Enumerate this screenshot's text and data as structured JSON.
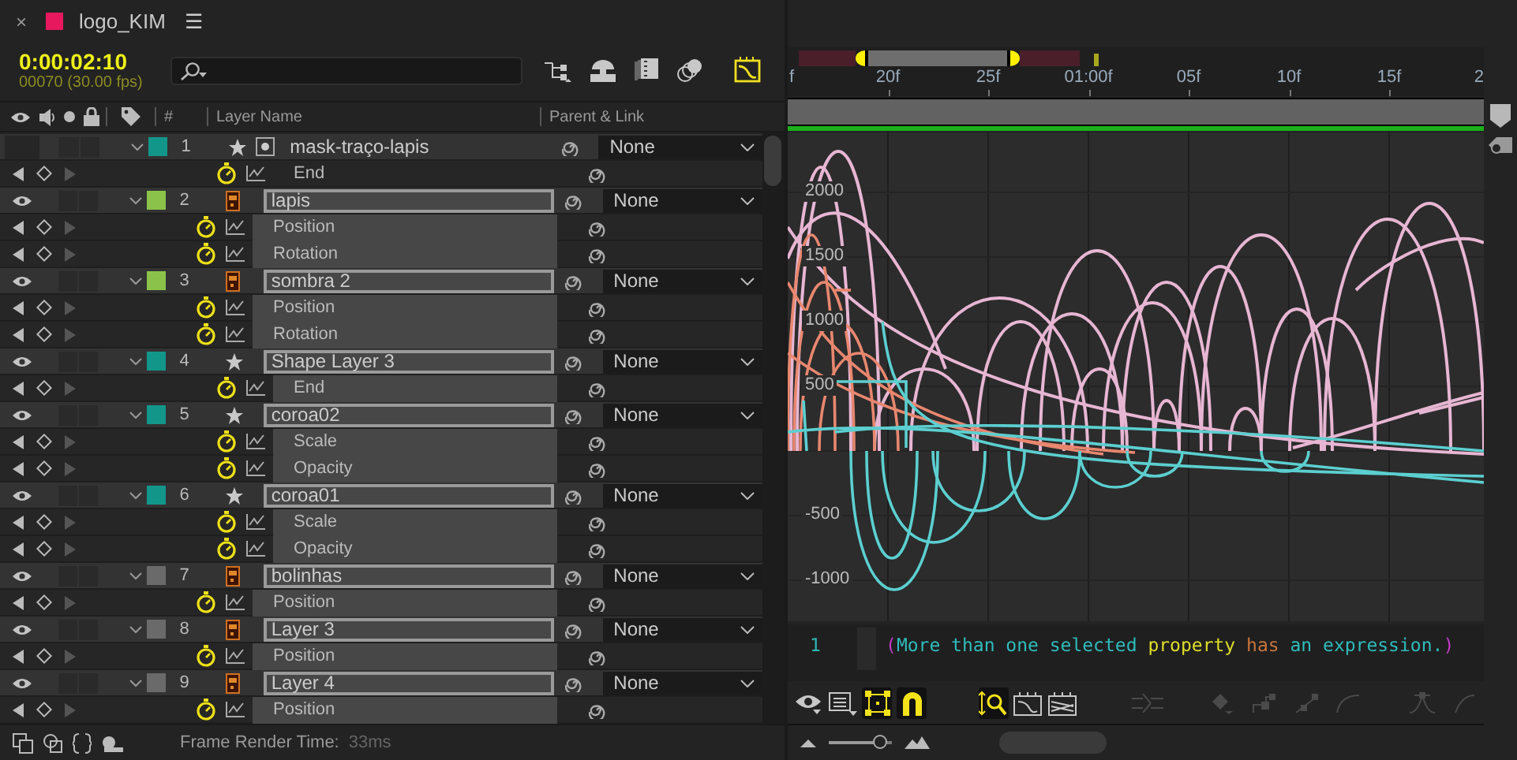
{
  "tab": {
    "close": "×",
    "title": "logo_KIM",
    "menu": "☰"
  },
  "timecode": "0:00:02:10",
  "frame": "00070 (30.00 fps)",
  "toolbar": [
    {
      "kind": "flowchart",
      "on": false
    },
    {
      "kind": "draft3d",
      "on": false
    },
    {
      "kind": "frameblend",
      "on": false
    },
    {
      "kind": "motionblur",
      "on": false
    },
    {
      "kind": "grapheditor",
      "on": true
    }
  ],
  "columns": [
    {
      "kind": "number",
      "label": "#"
    },
    {
      "kind": "name",
      "label": "Layer Name"
    },
    {
      "kind": "parent",
      "label": "Parent & Link"
    }
  ],
  "layers": [
    {
      "number": "1",
      "name": "mask-traço-lapis",
      "kind": "mask",
      "color": "#13968a",
      "visible": false,
      "solo": false,
      "locked": false,
      "selected": false,
      "parent": "None",
      "properties": [
        {
          "name": "End",
          "selected": false
        }
      ]
    },
    {
      "number": "2",
      "name": "lapis",
      "kind": "ai",
      "color": "#8bc34a",
      "visible": true,
      "solo": false,
      "locked": false,
      "selected": true,
      "parent": "None",
      "properties": [
        {
          "name": "Position",
          "selected": true
        },
        {
          "name": "Rotation",
          "selected": true
        }
      ]
    },
    {
      "number": "3",
      "name": "sombra 2",
      "kind": "ai",
      "color": "#8bc34a",
      "visible": true,
      "solo": false,
      "locked": false,
      "selected": true,
      "parent": "None",
      "properties": [
        {
          "name": "Position",
          "selected": true
        },
        {
          "name": "Rotation",
          "selected": true
        }
      ]
    },
    {
      "number": "4",
      "name": "Shape Layer 3",
      "kind": "shape",
      "color": "#13968a",
      "visible": true,
      "solo": false,
      "locked": false,
      "selected": true,
      "parent": "None",
      "properties": [
        {
          "name": "End",
          "selected": true
        }
      ]
    },
    {
      "number": "5",
      "name": "coroa02",
      "kind": "shape",
      "color": "#13968a",
      "visible": true,
      "solo": false,
      "locked": false,
      "selected": true,
      "parent": "None",
      "properties": [
        {
          "name": "Scale",
          "selected": true
        },
        {
          "name": "Opacity",
          "selected": true
        }
      ]
    },
    {
      "number": "6",
      "name": "coroa01",
      "kind": "shape",
      "color": "#13968a",
      "visible": true,
      "solo": false,
      "locked": false,
      "selected": true,
      "parent": "None",
      "properties": [
        {
          "name": "Scale",
          "selected": true
        },
        {
          "name": "Opacity",
          "selected": true
        }
      ]
    },
    {
      "number": "7",
      "name": "bolinhas",
      "kind": "ai",
      "color": "#6a6a6a",
      "visible": true,
      "solo": false,
      "locked": false,
      "selected": true,
      "parent": "None",
      "properties": [
        {
          "name": "Position",
          "selected": true
        }
      ]
    },
    {
      "number": "8",
      "name": "Layer 3",
      "kind": "ai",
      "color": "#6a6a6a",
      "visible": true,
      "solo": false,
      "locked": false,
      "selected": true,
      "parent": "None",
      "properties": [
        {
          "name": "Position",
          "selected": true
        }
      ]
    },
    {
      "number": "9",
      "name": "Layer 4",
      "kind": "ai",
      "color": "#6a6a6a",
      "visible": true,
      "solo": false,
      "locked": false,
      "selected": true,
      "parent": "None",
      "properties": [
        {
          "name": "Position",
          "selected": true
        }
      ]
    }
  ],
  "status": {
    "label": "Frame Render Time:",
    "value": "33ms"
  },
  "ruler": [
    "f",
    "20f",
    "25f",
    "01:00f",
    "05f",
    "10f",
    "15f",
    "2"
  ],
  "graph": {
    "y_labels": [
      "2000",
      "1500",
      "1000",
      "500",
      "-500",
      "-1000"
    ]
  },
  "expression": {
    "line": "1",
    "tokens": [
      {
        "kind": "paren",
        "text": "("
      },
      {
        "kind": "plain",
        "text": "More than one selected"
      },
      {
        "kind": "keyword",
        "text": "property"
      },
      {
        "kind": "operator",
        "text": "has"
      },
      {
        "kind": "plain",
        "text": "an expression."
      },
      {
        "kind": "paren",
        "text": ")"
      }
    ]
  },
  "graph_tools": [
    {
      "kind": "show",
      "on": false,
      "disabled": false
    },
    {
      "kind": "list",
      "on": false,
      "disabled": false
    },
    {
      "kind": "transform",
      "on": true,
      "disabled": false
    },
    {
      "kind": "snap",
      "on": true,
      "disabled": false
    },
    {
      "kind": "autozoom",
      "on": true,
      "disabled": false
    },
    {
      "kind": "fitselection",
      "on": false,
      "disabled": false
    },
    {
      "kind": "fitall",
      "on": false,
      "disabled": false
    },
    {
      "kind": "separate",
      "on": false,
      "disabled": true
    },
    {
      "kind": "keyframe",
      "on": false,
      "disabled": true
    },
    {
      "kind": "hold",
      "on": false,
      "disabled": true
    },
    {
      "kind": "linear",
      "on": false,
      "disabled": true
    },
    {
      "kind": "autobezier",
      "on": false,
      "disabled": true
    },
    {
      "kind": "easyease",
      "on": false,
      "disabled": true
    },
    {
      "kind": "easein",
      "on": false,
      "disabled": true
    }
  ],
  "zoom": {
    "level": 0.82
  }
}
